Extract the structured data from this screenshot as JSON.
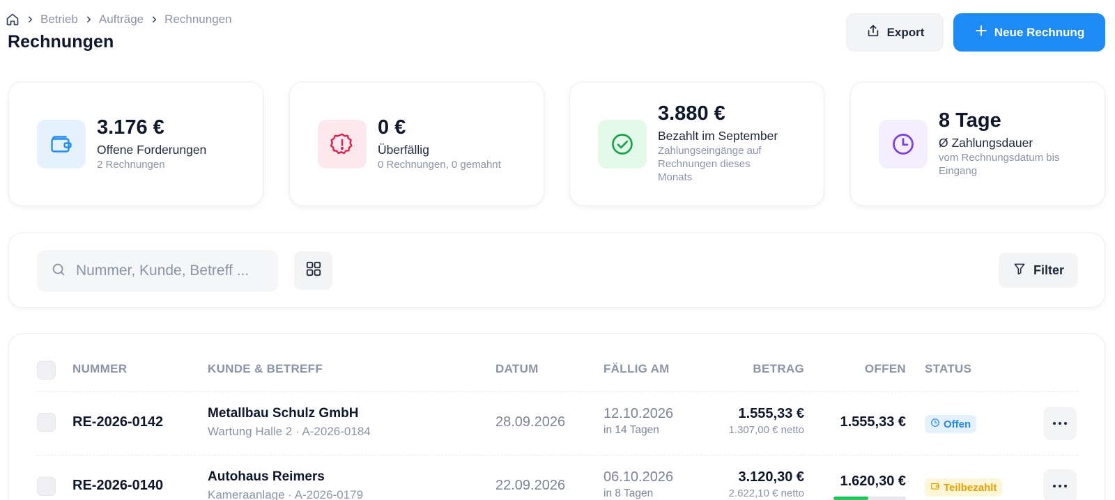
{
  "breadcrumb": [
    "Betrieb",
    "Aufträge",
    "Rechnungen"
  ],
  "page_title": "Rechnungen",
  "actions": {
    "export_label": "Export",
    "new_label": "Neue Rechnung"
  },
  "stats": [
    {
      "value": "3.176 €",
      "label": "Offene Forderungen",
      "sub": "2 Rechnungen",
      "icon": "wallet-icon",
      "color": "#1f8bf5",
      "bg": "#e6f1fe"
    },
    {
      "value": "0 €",
      "label": "Überfällig",
      "sub": "0 Rechnungen, 0 gemahnt",
      "icon": "alert-badge-icon",
      "color": "#e11d48",
      "bg": "#fde8ee"
    },
    {
      "value": "3.880 €",
      "label": "Bezahlt im September",
      "sub": "Zahlungseingänge auf Rechnungen dieses Monats",
      "icon": "check-circle-icon",
      "color": "#16a34a",
      "bg": "#e3f9ea"
    },
    {
      "value": "8 Tage",
      "label": "Ø Zahlungsdauer",
      "sub": "vom Rechnungsdatum bis Eingang",
      "icon": "clock-icon",
      "color": "#7c3aed",
      "bg": "#f3efff"
    }
  ],
  "search": {
    "placeholder": "Nummer, Kunde, Betreff ...",
    "value": ""
  },
  "filter_label": "Filter",
  "table": {
    "headers": {
      "number": "NUMMER",
      "customer": "KUNDE & BETREFF",
      "date": "DATUM",
      "due": "FÄLLIG AM",
      "amount": "BETRAG",
      "open": "OFFEN",
      "status": "STATUS"
    },
    "rows": [
      {
        "number": "RE-2026-0142",
        "customer": "Metallbau Schulz GmbH",
        "subject": "Wartung Halle 2 · A-2026-0184",
        "date": "28.09.2026",
        "due": "12.10.2026",
        "due_hint": "in 14 Tagen",
        "amount": "1.555,33 €",
        "net": "1.307,00 € netto",
        "open": "1.555,33 €",
        "status": "Offen",
        "status_color": "#1f8bf5"
      },
      {
        "number": "RE-2026-0140",
        "customer": "Autohaus Reimers",
        "subject": "Kameraanlage · A-2026-0179",
        "date": "22.09.2026",
        "due": "06.10.2026",
        "due_hint": "in 8 Tagen",
        "amount": "3.120,30 €",
        "net": "2.622,10 € netto",
        "open": "1.620,30 €",
        "paid_fraction": 0.48,
        "status": "Teilbezahlt",
        "status_color": "#e6a100"
      }
    ]
  }
}
